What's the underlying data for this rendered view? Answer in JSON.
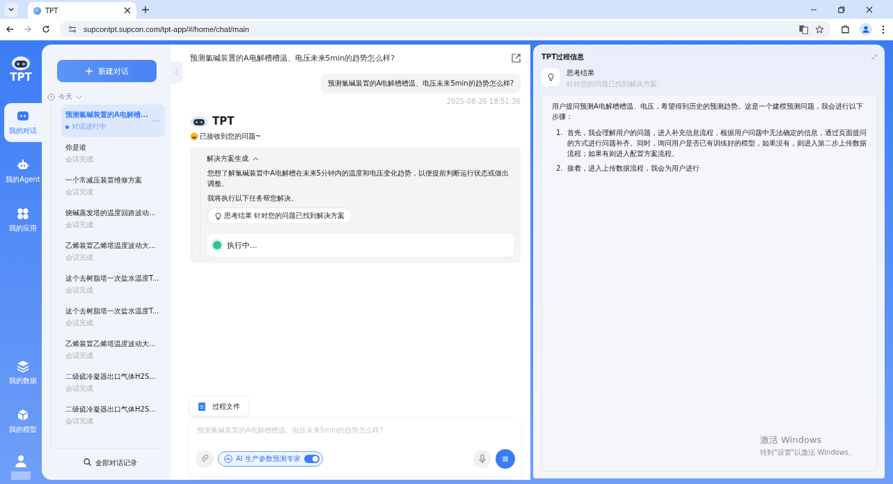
{
  "browser": {
    "tab_title": "TPT",
    "url": "supcontpt.supcon.com/tpt-app/#/home/chat/main"
  },
  "rail": {
    "logo_text": "TPT",
    "items": [
      {
        "label": "我的对话",
        "kind": "chat",
        "selected": true
      },
      {
        "label": "我的Agent",
        "kind": "agent",
        "selected": false
      },
      {
        "label": "我的应用",
        "kind": "apps",
        "selected": false
      },
      {
        "label": "我的数据",
        "kind": "data",
        "selected": false
      },
      {
        "label": "我的模型",
        "kind": "model",
        "selected": false
      }
    ]
  },
  "sidebar": {
    "new_chat": "新建对话",
    "group": "今天",
    "conversations": [
      {
        "title": "预测氯碱装置的A电解槽...",
        "status": "对话进行中",
        "selected": true
      },
      {
        "title": "你是谁",
        "status": "会话完成",
        "selected": false
      },
      {
        "title": "一个常减压装置维修方案",
        "status": "会话完成",
        "selected": false
      },
      {
        "title": "烧碱蒸发塔的温度回路波动...",
        "status": "会话完成",
        "selected": false
      },
      {
        "title": "乙烯装置乙烯塔温度波动大...",
        "status": "会话完成",
        "selected": false
      },
      {
        "title": "这个去树脂塔一次盐水温度T...",
        "status": "会话完成",
        "selected": false
      },
      {
        "title": "这个去树脂塔一次盐水温度T...",
        "status": "会话完成",
        "selected": false
      },
      {
        "title": "乙烯装置乙烯塔温度波动大...",
        "status": "会话完成",
        "selected": false
      },
      {
        "title": "二级硫冷凝器出口气体H2S...",
        "status": "会话完成",
        "selected": false
      },
      {
        "title": "二级硫冷凝器出口气体H2S...",
        "status": "会话完成",
        "selected": false
      }
    ],
    "footer": "全部对话记录"
  },
  "chat": {
    "title": "预测氯碱装置的A电解槽槽温、电压未来5min的趋势怎么样?",
    "user_message": "预测氯碱装置的A电解槽槽温、电压未来5min的趋势怎么样?",
    "timestamp": "2025-08-26 18:51:36",
    "bot_name": "TPT",
    "ack": "已接收到您的问题~",
    "plan": {
      "title": "解决方案生成",
      "expanded": true,
      "summary": "您想了解氯碱装置中A电解槽在未来5分钟内的温度和电压变化趋势，以便提前判断运行状态或做出调整。",
      "intro": "我将执行以下任务帮您解决。",
      "chip_title": "思考结果",
      "chip_text": "针对您的问题已找到解决方案",
      "task_status": "执行中..."
    },
    "file_button": "过程文件",
    "input": {
      "placeholder": "预测氯碱装置的A电解槽槽温、电压未来5min的趋势怎么样?"
    },
    "agent": {
      "label": "AI 生产参数预测专家",
      "on": true
    }
  },
  "process": {
    "title": "TPT过程信息",
    "thought_title": "思考结果",
    "thought_sub": "针对您的问题已找到解决方案",
    "intro": "用户提问预测A电解槽槽温、电压，希望得到历史的预测趋势。这是一个建模预测问题，我会进行以下步骤：",
    "steps": [
      {
        "number": "1.",
        "text": "首先，我会理解用户的问题，进入补充信息流程，根据用户问题中无法确定的信息，通过页面提问的方式进行问题补齐。同时，询问用户是否已有训练好的模型，如果没有，则进入第二步上传数据流程；如果有则进入配置方案流程。"
      },
      {
        "number": "2.",
        "text": "接着，进入上传数据流程，我会为用户进行"
      }
    ]
  },
  "os_notice": {
    "title": "激活 Windows",
    "text": "转到\"设置\"以激活 Windows。"
  }
}
